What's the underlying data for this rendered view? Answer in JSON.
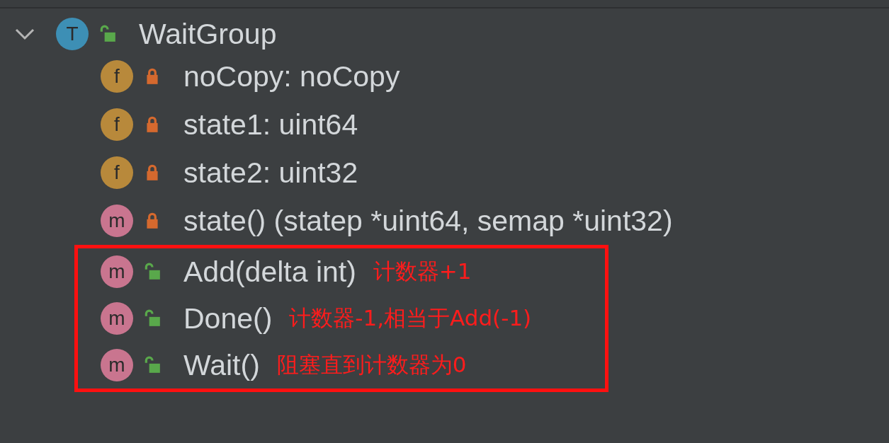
{
  "structure_tree": {
    "badge": "T",
    "kind": "type",
    "locked": false,
    "label": "WaitGroup",
    "expanded": true,
    "children": [
      {
        "badge": "f",
        "kind": "field",
        "locked": true,
        "label": "noCopy: noCopy",
        "highlighted": false
      },
      {
        "badge": "f",
        "kind": "field",
        "locked": true,
        "label": "state1: uint64",
        "highlighted": false
      },
      {
        "badge": "f",
        "kind": "field",
        "locked": true,
        "label": "state2: uint32",
        "highlighted": false
      },
      {
        "badge": "m",
        "kind": "method",
        "locked": true,
        "label": "state() (statep *uint64, semap *uint32)",
        "highlighted": false
      },
      {
        "badge": "m",
        "kind": "method",
        "locked": false,
        "label": "Add(delta int)",
        "highlighted": true,
        "note": "计数器+1"
      },
      {
        "badge": "m",
        "kind": "method",
        "locked": false,
        "label": "Done()",
        "highlighted": true,
        "note": "计数器-1,相当于Add(-1)"
      },
      {
        "badge": "m",
        "kind": "method",
        "locked": false,
        "label": "Wait()",
        "highlighted": true,
        "note": "阻塞直到计数器为0"
      }
    ]
  }
}
